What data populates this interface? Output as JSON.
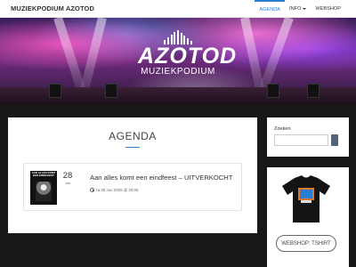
{
  "navbar": {
    "brand": "MUZIEKPODIUM AZOTOD",
    "items": [
      {
        "label": "AGENDA",
        "active": true
      },
      {
        "label": "INFO",
        "dropdown": true
      },
      {
        "label": "WEBSHOP"
      }
    ]
  },
  "hero": {
    "logo_title": "AZOTOD",
    "logo_subtitle": "MUZIEKPODIUM"
  },
  "main": {
    "title": "AGENDA",
    "events": [
      {
        "poster_text": "AAN ALLES KOMT EEN EINDFEEST",
        "day": "28",
        "month": "Jun",
        "title": "Aan alles komt een eindfeest – UITVERKOCHT",
        "datetime": "za 28 Jun 2025 @ 20:00"
      }
    ]
  },
  "sidebar": {
    "search_label": "Zoeken",
    "search_value": "",
    "shop_button": "WEBSHOP: TSHIRT"
  },
  "colors": {
    "accent": "#2a7fd4",
    "page_bg": "#181818",
    "search_button": "#52637a"
  },
  "icons": [
    "clock-icon",
    "search-icon",
    "chevron-down-icon"
  ]
}
